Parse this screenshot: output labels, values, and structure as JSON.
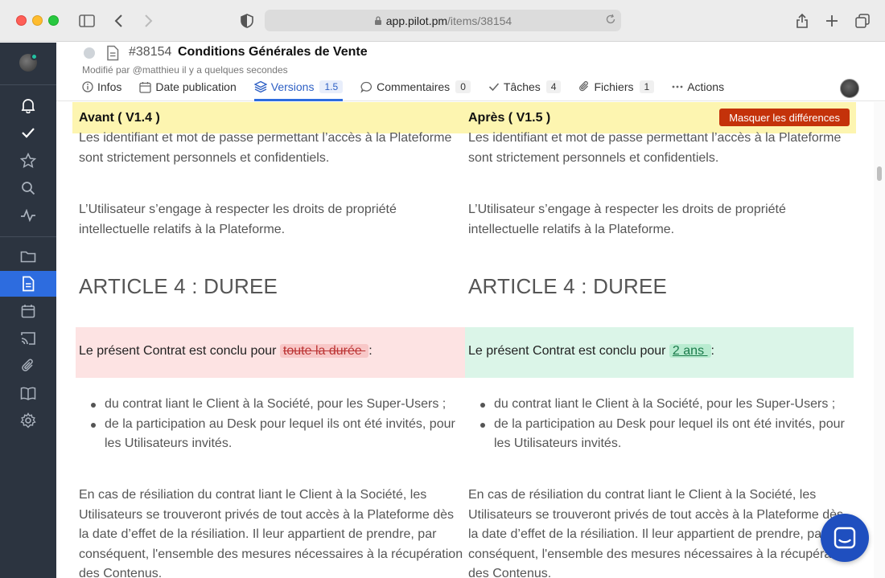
{
  "browser": {
    "url_host": "app.pilot.pm",
    "url_path": "/items/38154"
  },
  "item": {
    "id": "#38154",
    "title": "Conditions Générales de Vente",
    "modified": "Modifié par  @matthieu il y a quelques secondes"
  },
  "tabs": [
    {
      "label": "Infos",
      "count": ""
    },
    {
      "label": "Date publication",
      "count": ""
    },
    {
      "label": "Versions",
      "count": "1.5"
    },
    {
      "label": "Commentaires",
      "count": "0"
    },
    {
      "label": "Tâches",
      "count": "4"
    },
    {
      "label": "Fichiers",
      "count": "1"
    },
    {
      "label": "Actions",
      "count": ""
    }
  ],
  "diff": {
    "left_title": "Avant ( V1.4 )",
    "right_title": "Après ( V1.5 )",
    "toggle_label": "Masquer les différences"
  },
  "content": {
    "p1": "Les identifiant et mot de passe permettant l’accès à la Plateforme sont strictement personnels et confidentiels.",
    "p2": "L’Utilisateur s’engage à respecter les droits de propriété intellectuelle relatifs à la Plateforme.",
    "article": "ARTICLE 4 : DUREE",
    "diff_prefix": "Le présent Contrat est conclu pour ",
    "diff_suffix": " :",
    "deleted": "toute la durée ",
    "inserted": "2 ans ",
    "bullet1": "du contrat liant le Client à la Société, pour les Super-Users ;",
    "bullet2": "de la participation au Desk pour lequel ils ont été invités, pour les Utilisateurs invités.",
    "p3": "En cas de résiliation du contrat liant le Client à la Société, les Utilisateurs se trouveront privés de tout accès à la Plateforme dès la date d’effet de la résiliation. Il leur appartient de prendre, par conséquent, l'ensemble des  mesures nécessaires à la récupération des Contenus."
  },
  "colors": {
    "accent": "#2d6cdf",
    "sidebar": "#2c3440",
    "diff_header": "#fdf5b0",
    "removed_bg": "#fde3e3",
    "added_bg": "#dbf5e8",
    "toggle_button": "#c4320a"
  }
}
